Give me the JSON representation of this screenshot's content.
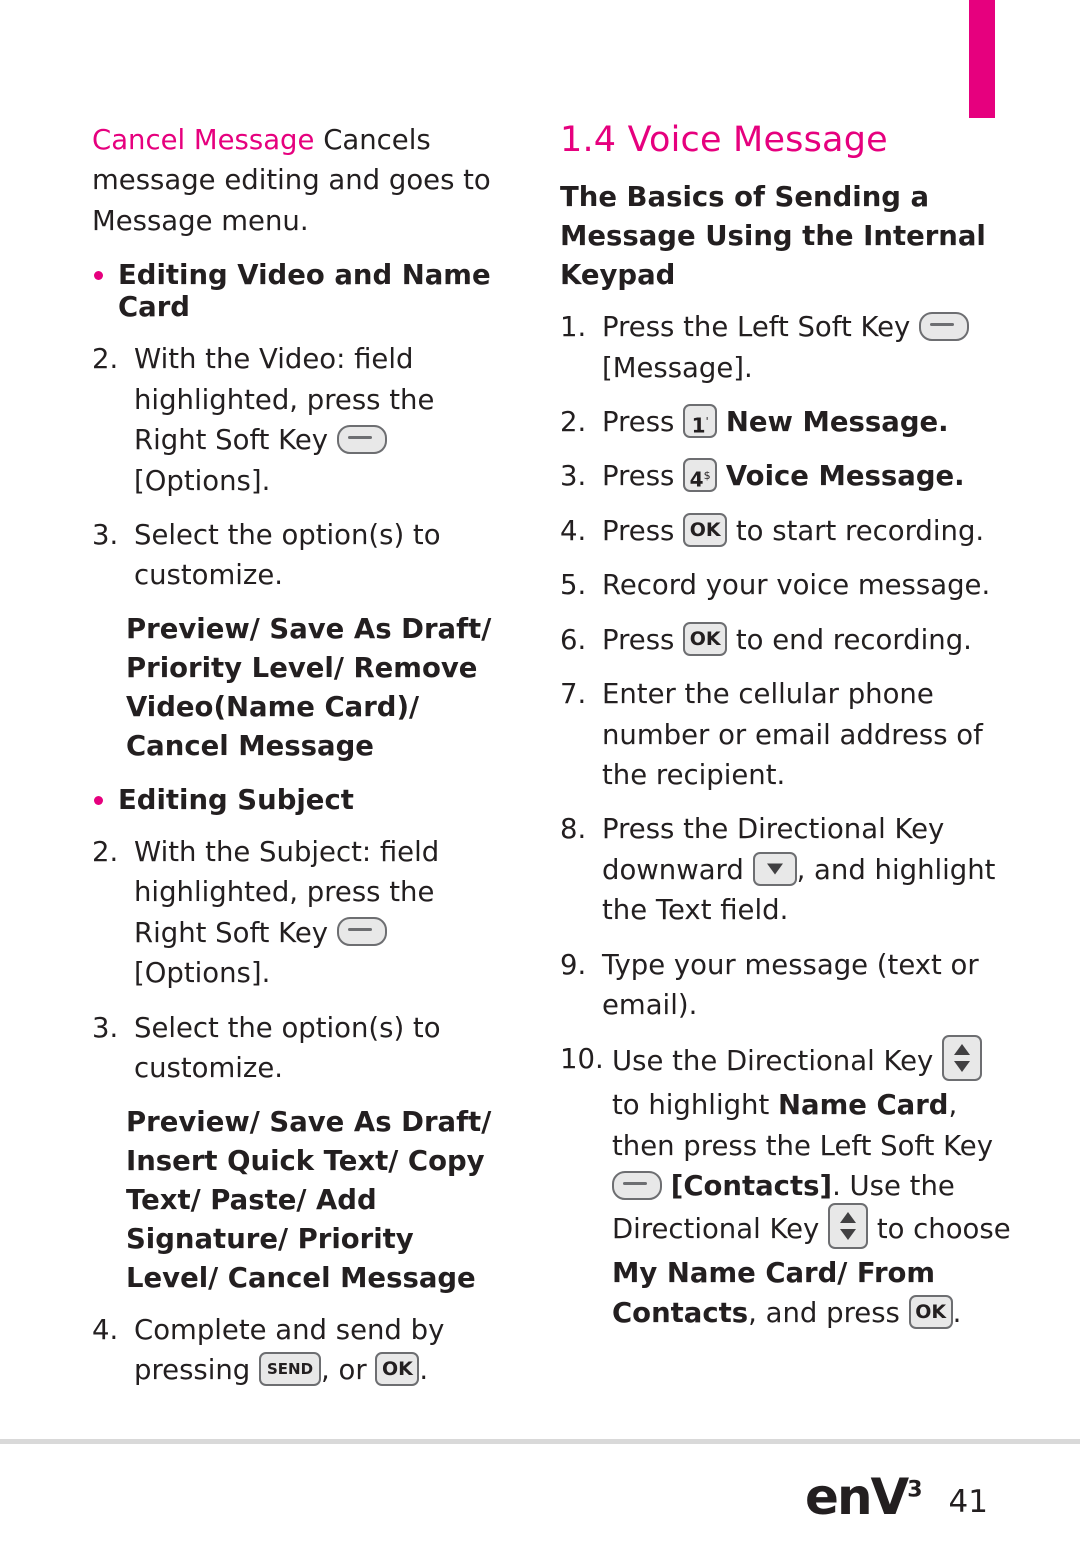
{
  "page": {
    "number": "41",
    "logo": "enV",
    "logo_superscript": "3",
    "accent_color": "#e6007e"
  },
  "left_column": {
    "cancel_message_para": {
      "term": "Cancel Message",
      "text": "Cancels message editing and goes to Message menu."
    },
    "bullet_editing_video": "Editing Video and Name Card",
    "step_video_2": {
      "num": "2.",
      "text_before": "With the Video: field highlighted, press the Right Soft Key",
      "key": "soft-key",
      "text_after": "[Options]."
    },
    "step_video_3": {
      "num": "3.",
      "text": "Select the option(s) to customize."
    },
    "video_options": "Preview/ Save As Draft/ Priority Level/ Remove Video(Name Card)/ Cancel Message",
    "bullet_editing_subject": "Editing Subject",
    "step_subject_2": {
      "num": "2.",
      "text_before": "With the Subject: field highlighted, press the Right Soft Key",
      "key": "soft-key",
      "text_after": "[Options]."
    },
    "step_subject_3": {
      "num": "3.",
      "text": "Select the option(s) to customize."
    },
    "subject_options": "Preview/ Save As Draft/ Insert Quick Text/ Copy Text/ Paste/ Add Signature/ Priority Level/ Cancel Message",
    "step_subject_4": {
      "num": "4.",
      "text": "Complete and send by pressing",
      "key_send": "SEND",
      "joiner": ", or",
      "key_ok": "OK",
      "period": "."
    }
  },
  "right_column": {
    "section_title": "1.4 Voice Message",
    "sub_title": "The Basics of Sending a Message Using the Internal Keypad",
    "steps": [
      {
        "num": "1.",
        "text_before": "Press the Left Soft Key",
        "key": "soft-key",
        "text_after": "[Message]."
      },
      {
        "num": "2.",
        "text_before": "Press",
        "key_label": "1",
        "key_sup": "'",
        "text_after": "New Message."
      },
      {
        "num": "3.",
        "text_before": "Press",
        "key_label": "4",
        "key_sup": "$",
        "text_after": "Voice Message."
      },
      {
        "num": "4.",
        "text_before": "Press",
        "key_label": "OK",
        "text_after": "to start recording."
      },
      {
        "num": "5.",
        "text": "Record your voice message."
      },
      {
        "num": "6.",
        "text_before": "Press",
        "key_label": "OK",
        "text_after": "to end recording."
      },
      {
        "num": "7.",
        "text": "Enter the cellular phone number or email address of the recipient."
      },
      {
        "num": "8.",
        "text_before": "Press the Directional Key downward",
        "key": "down-arrow-key",
        "text_after": ", and highlight the Text field."
      },
      {
        "num": "9.",
        "text": "Type your message (text or email)."
      },
      {
        "num": "10.",
        "part1": "Use the Directional Key",
        "part2_before": "to highlight",
        "part2_bold": "Name Card",
        "part2_after": ", then press the Left Soft Key",
        "part3_bold": "[Contacts]",
        "part3_text": ". Use the Directional Key",
        "part4": "to choose",
        "part5_bold": "My Name Card/ From Contacts",
        "part5_text": ", and press",
        "key_ok": "OK",
        "period": "."
      }
    ]
  },
  "keys": {
    "ok": "OK",
    "send": "SEND"
  }
}
